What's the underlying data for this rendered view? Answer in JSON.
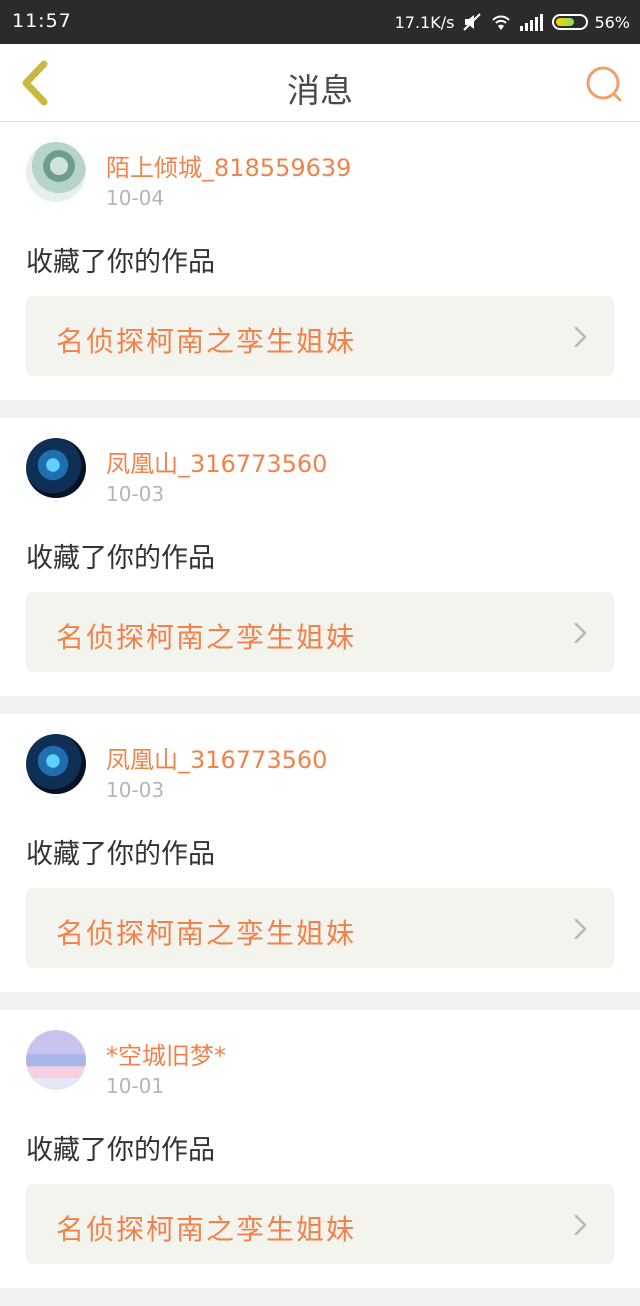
{
  "status_bar": {
    "time": "11:57",
    "net_speed": "17.1K/s",
    "battery": "56%"
  },
  "navbar": {
    "title": "消息",
    "back_icon": "chevron-left-icon",
    "search_icon": "search-icon"
  },
  "colors": {
    "accent": "#f0834c",
    "back_icon": "#c8b93f",
    "search_icon": "#f0a06a"
  },
  "messages": [
    {
      "username": "陌上倾城_818559639",
      "date": "10-04",
      "action": "收藏了你的作品",
      "work_title": "名侦探柯南之孪生姐妹"
    },
    {
      "username": "凤凰山_316773560",
      "date": "10-03",
      "action": "收藏了你的作品",
      "work_title": "名侦探柯南之孪生姐妹"
    },
    {
      "username": "凤凰山_316773560",
      "date": "10-03",
      "action": "收藏了你的作品",
      "work_title": "名侦探柯南之孪生姐妹"
    },
    {
      "username": "*空城旧梦*",
      "date": "10-01",
      "action": "收藏了你的作品",
      "work_title": "名侦探柯南之孪生姐妹"
    }
  ]
}
